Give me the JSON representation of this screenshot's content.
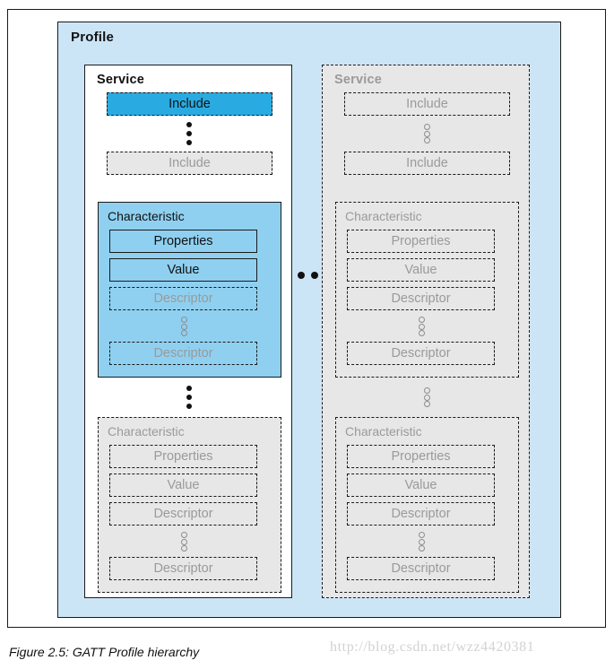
{
  "figure": {
    "caption": "Figure 2.5:  GATT Profile hierarchy",
    "watermark": "http://blog.csdn.net/wzz4420381"
  },
  "colors": {
    "profile_background": "#cce5f6",
    "service_active_background": "#ffffff",
    "service_ghost_background": "#e7e7e7",
    "include_highlight": "#29abe2",
    "characteristic_highlight": "#8fd0f0",
    "active_text": "#111111",
    "ghost_text": "#9a9a9a",
    "border": "#1a1a1a"
  },
  "profile": {
    "title": "Profile",
    "services": [
      {
        "title": "Service",
        "state": "active",
        "includes": [
          {
            "label": "Include",
            "state": "highlighted"
          },
          {
            "label": "Include",
            "state": "ghost"
          }
        ],
        "characteristics": [
          {
            "label": "Characteristic",
            "state": "highlighted",
            "properties_label": "Properties",
            "value_label": "Value",
            "descriptors": [
              {
                "label": "Descriptor",
                "state": "ghost"
              },
              {
                "label": "Descriptor",
                "state": "ghost"
              }
            ]
          },
          {
            "label": "Characteristic",
            "state": "ghost",
            "properties_label": "Properties",
            "value_label": "Value",
            "descriptors": [
              {
                "label": "Descriptor",
                "state": "ghost"
              },
              {
                "label": "Descriptor",
                "state": "ghost"
              }
            ]
          }
        ]
      },
      {
        "title": "Service",
        "state": "ghost",
        "includes": [
          {
            "label": "Include",
            "state": "ghost"
          },
          {
            "label": "Include",
            "state": "ghost"
          }
        ],
        "characteristics": [
          {
            "label": "Characteristic",
            "state": "ghost",
            "properties_label": "Properties",
            "value_label": "Value",
            "descriptors": [
              {
                "label": "Descriptor",
                "state": "ghost"
              },
              {
                "label": "Descriptor",
                "state": "ghost"
              }
            ]
          },
          {
            "label": "Characteristic",
            "state": "ghost",
            "properties_label": "Properties",
            "value_label": "Value",
            "descriptors": [
              {
                "label": "Descriptor",
                "state": "ghost"
              },
              {
                "label": "Descriptor",
                "state": "ghost"
              }
            ]
          }
        ]
      }
    ],
    "service_ellipsis": "horizontal-three-dots"
  }
}
